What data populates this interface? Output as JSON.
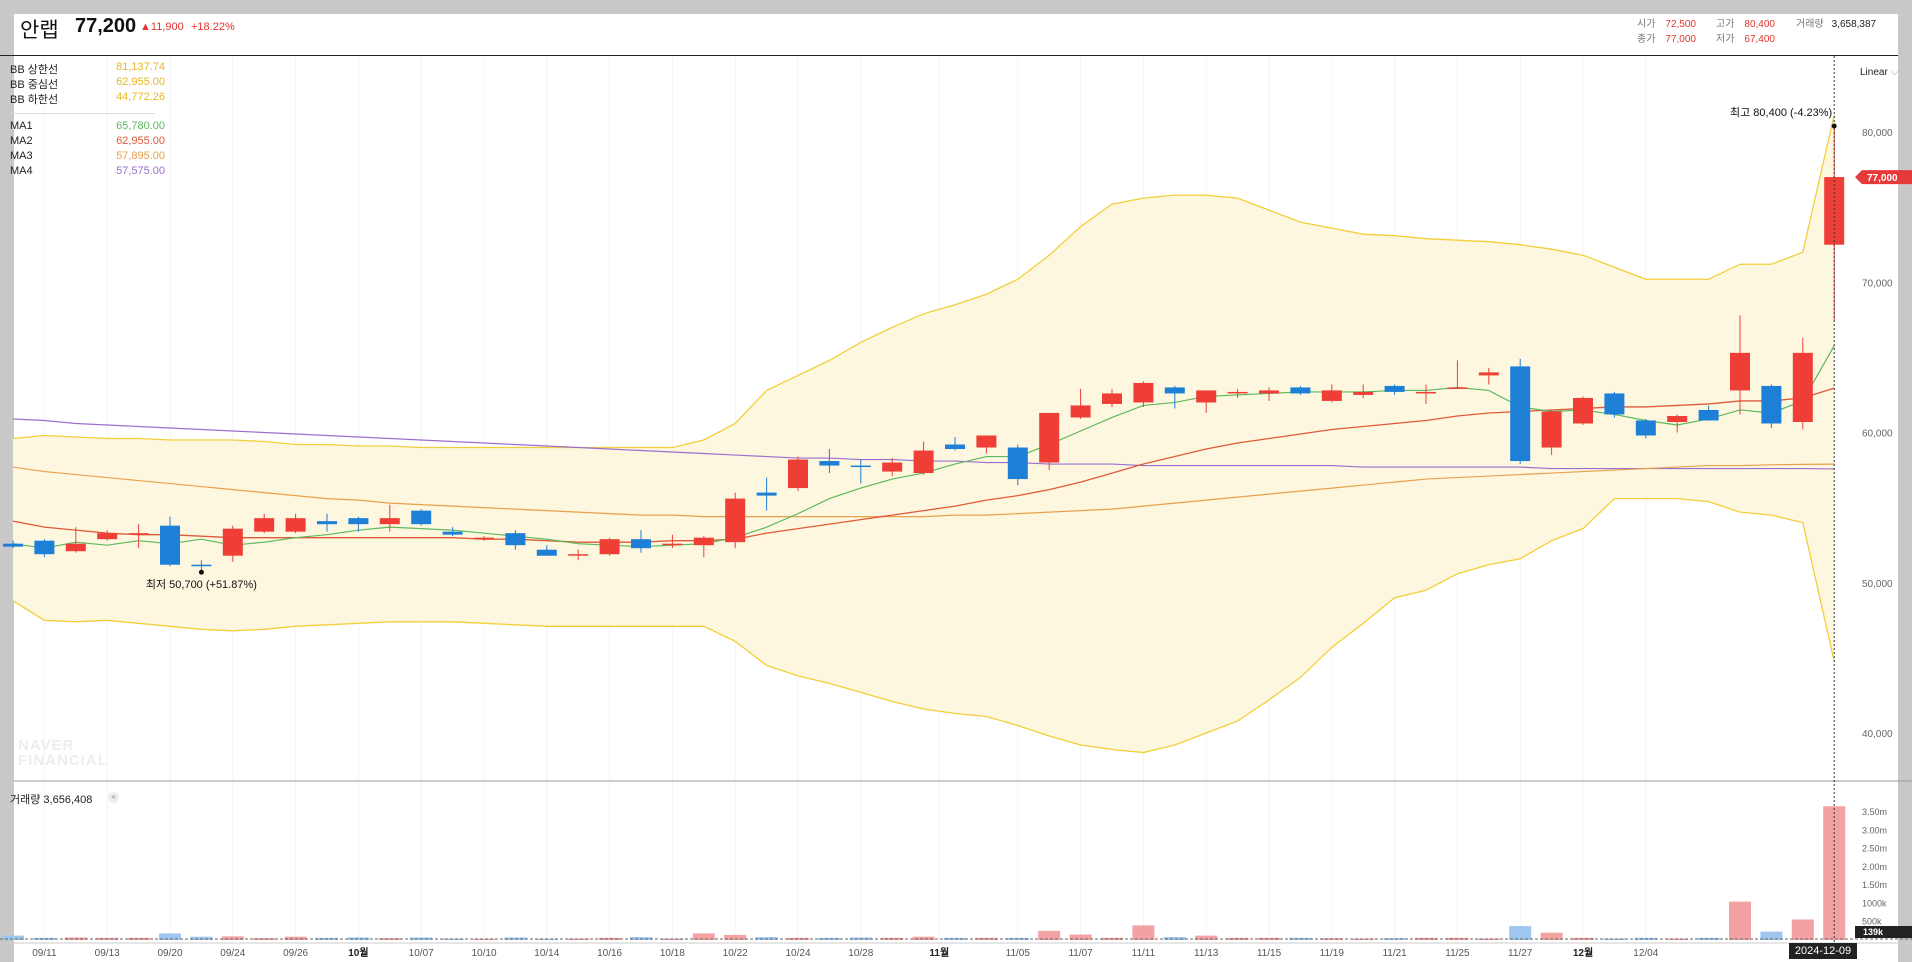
{
  "header": {
    "name": "안랩",
    "price": "77,200",
    "change": "▲11,900",
    "change_pct": "+18.22%",
    "open_label": "시가",
    "open": "72,500",
    "high_label": "고가",
    "high": "80,400",
    "volume_label": "거래량",
    "volume": "3,658,387",
    "close_label": "종가",
    "close": "77,000",
    "low_label": "저가",
    "low": "67,400"
  },
  "legend": {
    "bb_upper_label": "BB 상한선",
    "bb_upper": "81,137.74",
    "bb_mid_label": "BB 중심선",
    "bb_mid": "62,955.00",
    "bb_lower_label": "BB 하한선",
    "bb_lower": "44,772.26",
    "ma1_label": "MA1",
    "ma1": "65,780.00",
    "ma2_label": "MA2",
    "ma2": "62,955.00",
    "ma3_label": "MA3",
    "ma3": "57,895.00",
    "ma4_label": "MA4",
    "ma4": "57,575.00"
  },
  "scale_mode": "Linear",
  "volume_panel": {
    "label": "거래량 3,656,408",
    "close_icon": "×"
  },
  "watermark": [
    "NAVER",
    "FINANCIAL"
  ],
  "date_badge": "2024-12-09",
  "colors": {
    "up": "#ef3e36",
    "down": "#1e7fd6",
    "ma1": "#5cb85c",
    "ma2": "#e05a3a",
    "ma3": "#e8a04c",
    "ma4": "#9b6fcf",
    "bb": "#f2cf3a",
    "bb_fill": "#fdf7df"
  },
  "chart_data": {
    "type": "candlestick",
    "price_axis": {
      "min": 40000,
      "max": 80000,
      "ticks": [
        "40,000",
        "50,000",
        "60,000",
        "70,000",
        "80,000"
      ]
    },
    "volume_axis": {
      "ticks": [
        "500k",
        "1000k",
        "1.50m",
        "2.00m",
        "2.50m",
        "3.00m",
        "3.50m"
      ]
    },
    "x_labels": [
      {
        "i": 1,
        "t": "09/11"
      },
      {
        "i": 3,
        "t": "09/13"
      },
      {
        "i": 5,
        "t": "09/20"
      },
      {
        "i": 7,
        "t": "09/24"
      },
      {
        "i": 9,
        "t": "09/26"
      },
      {
        "i": 11,
        "t": "10월",
        "bold": true
      },
      {
        "i": 13,
        "t": "10/07"
      },
      {
        "i": 15,
        "t": "10/10"
      },
      {
        "i": 17,
        "t": "10/14"
      },
      {
        "i": 19,
        "t": "10/16"
      },
      {
        "i": 21,
        "t": "10/18"
      },
      {
        "i": 23,
        "t": "10/22"
      },
      {
        "i": 25,
        "t": "10/24"
      },
      {
        "i": 27,
        "t": "10/28"
      },
      {
        "i": 29.5,
        "t": "11월",
        "bold": true
      },
      {
        "i": 32,
        "t": "11/05"
      },
      {
        "i": 34,
        "t": "11/07"
      },
      {
        "i": 36,
        "t": "11/11"
      },
      {
        "i": 38,
        "t": "11/13"
      },
      {
        "i": 40,
        "t": "11/15"
      },
      {
        "i": 42,
        "t": "11/19"
      },
      {
        "i": 44,
        "t": "11/21"
      },
      {
        "i": 46,
        "t": "11/25"
      },
      {
        "i": 48,
        "t": "11/27"
      },
      {
        "i": 50,
        "t": "12월",
        "bold": true
      },
      {
        "i": 52,
        "t": "12/04"
      }
    ],
    "candles": [
      {
        "o": 52600,
        "h": 52800,
        "l": 52300,
        "c": 52400
      },
      {
        "o": 52800,
        "h": 52900,
        "l": 51700,
        "c": 51900
      },
      {
        "o": 52100,
        "h": 53700,
        "l": 52000,
        "c": 52600
      },
      {
        "o": 52900,
        "h": 53500,
        "l": 52800,
        "c": 53300
      },
      {
        "o": 53300,
        "h": 53900,
        "l": 52300,
        "c": 53300
      },
      {
        "o": 53800,
        "h": 54400,
        "l": 51100,
        "c": 51200
      },
      {
        "o": 51200,
        "h": 51500,
        "l": 50700,
        "c": 51100
      },
      {
        "o": 51800,
        "h": 53800,
        "l": 51400,
        "c": 53600
      },
      {
        "o": 53400,
        "h": 54600,
        "l": 53300,
        "c": 54300
      },
      {
        "o": 53400,
        "h": 54600,
        "l": 53300,
        "c": 54300
      },
      {
        "o": 54100,
        "h": 54600,
        "l": 53400,
        "c": 53900
      },
      {
        "o": 54300,
        "h": 54400,
        "l": 53400,
        "c": 53900
      },
      {
        "o": 53900,
        "h": 55200,
        "l": 53400,
        "c": 54300
      },
      {
        "o": 54800,
        "h": 54900,
        "l": 53800,
        "c": 53900
      },
      {
        "o": 53400,
        "h": 53700,
        "l": 53100,
        "c": 53200
      },
      {
        "o": 52900,
        "h": 53100,
        "l": 52800,
        "c": 53000
      },
      {
        "o": 53300,
        "h": 53500,
        "l": 52200,
        "c": 52500
      },
      {
        "o": 52200,
        "h": 52500,
        "l": 51900,
        "c": 51800
      },
      {
        "o": 51800,
        "h": 52200,
        "l": 51500,
        "c": 51900
      },
      {
        "o": 51900,
        "h": 53000,
        "l": 51800,
        "c": 52900
      },
      {
        "o": 52900,
        "h": 53500,
        "l": 52000,
        "c": 52300
      },
      {
        "o": 52600,
        "h": 53200,
        "l": 52300,
        "c": 52600
      },
      {
        "o": 52500,
        "h": 53100,
        "l": 51700,
        "c": 53000
      },
      {
        "o": 52700,
        "h": 56000,
        "l": 52300,
        "c": 55600
      },
      {
        "o": 56000,
        "h": 57000,
        "l": 54800,
        "c": 55800
      },
      {
        "o": 56300,
        "h": 58400,
        "l": 56100,
        "c": 58200
      },
      {
        "o": 58100,
        "h": 58900,
        "l": 57300,
        "c": 57800
      },
      {
        "o": 57800,
        "h": 58200,
        "l": 56600,
        "c": 57700
      },
      {
        "o": 57400,
        "h": 58300,
        "l": 57100,
        "c": 58000
      },
      {
        "o": 57300,
        "h": 59400,
        "l": 57200,
        "c": 58800
      },
      {
        "o": 59200,
        "h": 59700,
        "l": 58800,
        "c": 58900
      },
      {
        "o": 59000,
        "h": 59600,
        "l": 58600,
        "c": 59800
      },
      {
        "o": 59000,
        "h": 59200,
        "l": 56500,
        "c": 56900
      },
      {
        "o": 58000,
        "h": 61300,
        "l": 57500,
        "c": 61300
      },
      {
        "o": 61000,
        "h": 62900,
        "l": 60900,
        "c": 61800
      },
      {
        "o": 61900,
        "h": 62900,
        "l": 61700,
        "c": 62600
      },
      {
        "o": 62000,
        "h": 63400,
        "l": 61700,
        "c": 63300
      },
      {
        "o": 63000,
        "h": 63100,
        "l": 61600,
        "c": 62600
      },
      {
        "o": 62000,
        "h": 62800,
        "l": 61300,
        "c": 62800
      },
      {
        "o": 62700,
        "h": 62900,
        "l": 62300,
        "c": 62700
      },
      {
        "o": 62600,
        "h": 63000,
        "l": 62100,
        "c": 62800
      },
      {
        "o": 63000,
        "h": 63100,
        "l": 62500,
        "c": 62600
      },
      {
        "o": 62100,
        "h": 63200,
        "l": 62000,
        "c": 62800
      },
      {
        "o": 62500,
        "h": 63200,
        "l": 62300,
        "c": 62700
      },
      {
        "o": 63100,
        "h": 63200,
        "l": 62500,
        "c": 62700
      },
      {
        "o": 62700,
        "h": 63200,
        "l": 61900,
        "c": 62700
      },
      {
        "o": 62900,
        "h": 64800,
        "l": 62900,
        "c": 63000
      },
      {
        "o": 63800,
        "h": 64300,
        "l": 63200,
        "c": 64000
      },
      {
        "o": 64400,
        "h": 64900,
        "l": 57900,
        "c": 58100
      },
      {
        "o": 59000,
        "h": 61500,
        "l": 58500,
        "c": 61400
      },
      {
        "o": 60600,
        "h": 62400,
        "l": 60500,
        "c": 62300
      },
      {
        "o": 62600,
        "h": 62700,
        "l": 61000,
        "c": 61200
      },
      {
        "o": 60800,
        "h": 60900,
        "l": 59600,
        "c": 59800
      },
      {
        "o": 60700,
        "h": 61200,
        "l": 60000,
        "c": 61100
      },
      {
        "o": 61500,
        "h": 61800,
        "l": 60800,
        "c": 60800
      },
      {
        "o": 62800,
        "h": 67800,
        "l": 61200,
        "c": 65300
      },
      {
        "o": 63100,
        "h": 63200,
        "l": 60300,
        "c": 60600
      },
      {
        "o": 60700,
        "h": 66300,
        "l": 60200,
        "c": 65300
      },
      {
        "o": 72500,
        "h": 80400,
        "l": 67400,
        "c": 77000
      }
    ],
    "volume": [
      120000,
      60000,
      70000,
      60000,
      60000,
      180000,
      90000,
      100000,
      50000,
      90000,
      60000,
      70000,
      50000,
      70000,
      40000,
      30000,
      70000,
      30000,
      40000,
      60000,
      80000,
      40000,
      180000,
      140000,
      80000,
      60000,
      60000,
      70000,
      60000,
      90000,
      60000,
      60000,
      60000,
      250000,
      150000,
      60000,
      400000,
      80000,
      120000,
      60000,
      60000,
      60000,
      50000,
      40000,
      50000,
      60000,
      60000,
      40000,
      380000,
      200000,
      60000,
      40000,
      60000,
      40000,
      60000,
      1050000,
      230000,
      560000,
      3656408
    ],
    "ma1": [
      52600,
      52300,
      52700,
      52500,
      52800,
      52600,
      52900,
      52500,
      52700,
      53000,
      53200,
      53500,
      53700,
      53600,
      53500,
      53300,
      53100,
      52900,
      52600,
      52500,
      52400,
      52500,
      52600,
      53000,
      53700,
      54600,
      55600,
      56300,
      56900,
      57300,
      57900,
      58400,
      58400,
      59200,
      60100,
      61000,
      61800,
      62000,
      62400,
      62500,
      62600,
      62700,
      62700,
      62700,
      62800,
      62800,
      63000,
      62800,
      61700,
      61400,
      61500,
      61200,
      60800,
      60500,
      60900,
      61500,
      61300,
      62100,
      65780
    ],
    "ma2": [
      54100,
      53700,
      53500,
      53300,
      53200,
      53200,
      53100,
      53000,
      53000,
      53000,
      53000,
      53000,
      53000,
      53000,
      53000,
      52900,
      52900,
      52800,
      52700,
      52700,
      52700,
      52800,
      52800,
      52900,
      53300,
      53600,
      53900,
      54200,
      54500,
      54800,
      55100,
      55500,
      55800,
      56200,
      56700,
      57300,
      57900,
      58400,
      58900,
      59300,
      59600,
      59900,
      60200,
      60400,
      60600,
      60800,
      61100,
      61300,
      61400,
      61500,
      61600,
      61700,
      61700,
      61800,
      61900,
      62100,
      62100,
      62300,
      62955
    ],
    "ma3": [
      57700,
      57400,
      57200,
      57000,
      56800,
      56600,
      56400,
      56200,
      56000,
      55800,
      55600,
      55500,
      55300,
      55200,
      55100,
      55000,
      54900,
      54800,
      54700,
      54600,
      54500,
      54500,
      54400,
      54400,
      54400,
      54400,
      54400,
      54400,
      54400,
      54400,
      54500,
      54500,
      54600,
      54700,
      54800,
      54900,
      55100,
      55300,
      55500,
      55700,
      55900,
      56100,
      56300,
      56500,
      56700,
      56900,
      57000,
      57100,
      57200,
      57300,
      57400,
      57500,
      57600,
      57700,
      57800,
      57800,
      57850,
      57880,
      57895
    ],
    "ma4": [
      60900,
      60800,
      60600,
      60500,
      60400,
      60300,
      60200,
      60100,
      60000,
      59900,
      59800,
      59700,
      59600,
      59500,
      59400,
      59300,
      59200,
      59100,
      59000,
      58900,
      58800,
      58700,
      58600,
      58500,
      58400,
      58300,
      58300,
      58200,
      58200,
      58100,
      58100,
      58000,
      58000,
      57900,
      57900,
      57900,
      57800,
      57800,
      57800,
      57800,
      57800,
      57800,
      57800,
      57700,
      57700,
      57700,
      57700,
      57700,
      57700,
      57600,
      57600,
      57600,
      57600,
      57600,
      57600,
      57600,
      57600,
      57600,
      57575
    ],
    "bb_upper": [
      59600,
      59800,
      59700,
      59600,
      59600,
      59500,
      59500,
      59500,
      59400,
      59200,
      59200,
      59100,
      59100,
      59000,
      59000,
      59000,
      59000,
      59000,
      59000,
      59000,
      59000,
      59000,
      59500,
      60600,
      62800,
      63800,
      64800,
      66000,
      67000,
      67900,
      68500,
      69200,
      70200,
      71800,
      73700,
      75200,
      75600,
      75800,
      75800,
      75600,
      74800,
      74000,
      73600,
      73200,
      73100,
      72900,
      72800,
      72700,
      72500,
      72200,
      71800,
      71000,
      70200,
      70200,
      70200,
      71200,
      71200,
      72000,
      81137.74
    ],
    "bb_lower": [
      48800,
      47500,
      47400,
      47500,
      47300,
      47100,
      46900,
      46800,
      46900,
      47100,
      47200,
      47300,
      47400,
      47400,
      47400,
      47300,
      47200,
      47100,
      47100,
      47100,
      47100,
      47100,
      47100,
      46100,
      44500,
      43800,
      43300,
      42700,
      42100,
      41600,
      41300,
      41100,
      40500,
      39800,
      39200,
      38900,
      38700,
      39200,
      40000,
      40800,
      42200,
      43700,
      45700,
      47300,
      49000,
      49500,
      50600,
      51200,
      51600,
      52800,
      53600,
      55600,
      55600,
      55600,
      55400,
      54700,
      54500,
      54000,
      44772.26
    ],
    "annotations": [
      {
        "label": "최고 80,400 (-4.23%)",
        "index": 58,
        "value": 80400
      },
      {
        "label": "최저 50,700 (+51.87%)",
        "index": 6,
        "value": 50700
      }
    ],
    "last_price_tag": "77,000",
    "volume_tag": "139k"
  }
}
